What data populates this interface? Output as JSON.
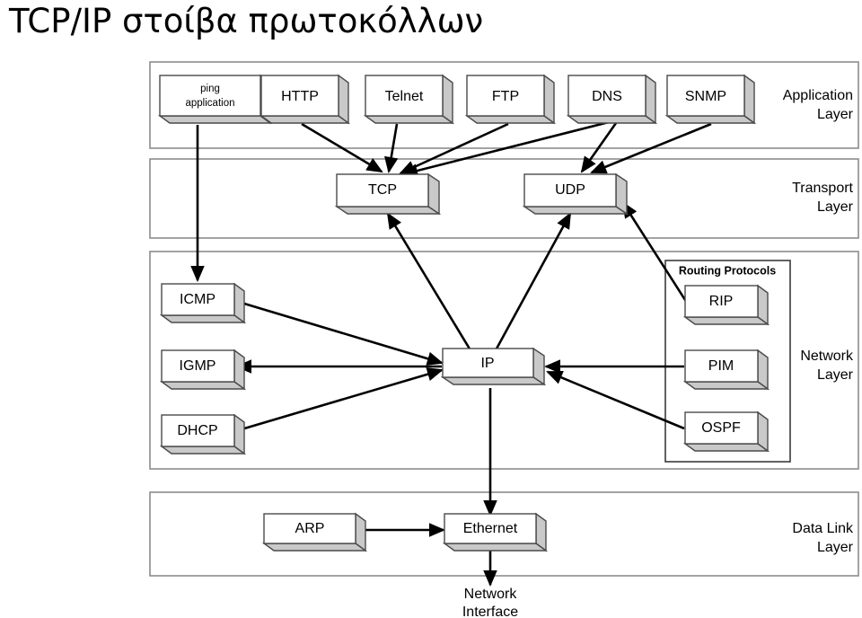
{
  "title": "TCP/IP στοίβα πρωτοκόλλων",
  "layers": [
    {
      "id": "application",
      "label_line1": "Application",
      "label_line2": "Layer"
    },
    {
      "id": "transport",
      "label_line1": "Transport",
      "label_line2": "Layer"
    },
    {
      "id": "network",
      "label_line1": "Network",
      "label_line2": "Layer"
    },
    {
      "id": "datalink",
      "label_line1": "Data Link",
      "label_line2": "Layer"
    }
  ],
  "groups": [
    {
      "id": "routing-protocols",
      "label": "Routing Protocols"
    }
  ],
  "boxes": {
    "ping": {
      "line1": "ping",
      "line2": "application"
    },
    "http": {
      "label": "HTTP"
    },
    "telnet": {
      "label": "Telnet"
    },
    "ftp": {
      "label": "FTP"
    },
    "dns": {
      "label": "DNS"
    },
    "snmp": {
      "label": "SNMP"
    },
    "tcp": {
      "label": "TCP"
    },
    "udp": {
      "label": "UDP"
    },
    "icmp": {
      "label": "ICMP"
    },
    "igmp": {
      "label": "IGMP"
    },
    "dhcp": {
      "label": "DHCP"
    },
    "ip": {
      "label": "IP"
    },
    "rip": {
      "label": "RIP"
    },
    "pim": {
      "label": "PIM"
    },
    "ospf": {
      "label": "OSPF"
    },
    "arp": {
      "label": "ARP"
    },
    "ethernet": {
      "label": "Ethernet"
    }
  },
  "outside": {
    "network_interface_line1": "Network",
    "network_interface_line2": "Interface"
  },
  "colors": {
    "box_fill": "#ffffff",
    "box_shadow": "#c9c9c9",
    "box_stroke": "#4a4a4a",
    "layer_stroke": "#8c8c8c",
    "arrow": "#000000",
    "text": "#000000"
  }
}
